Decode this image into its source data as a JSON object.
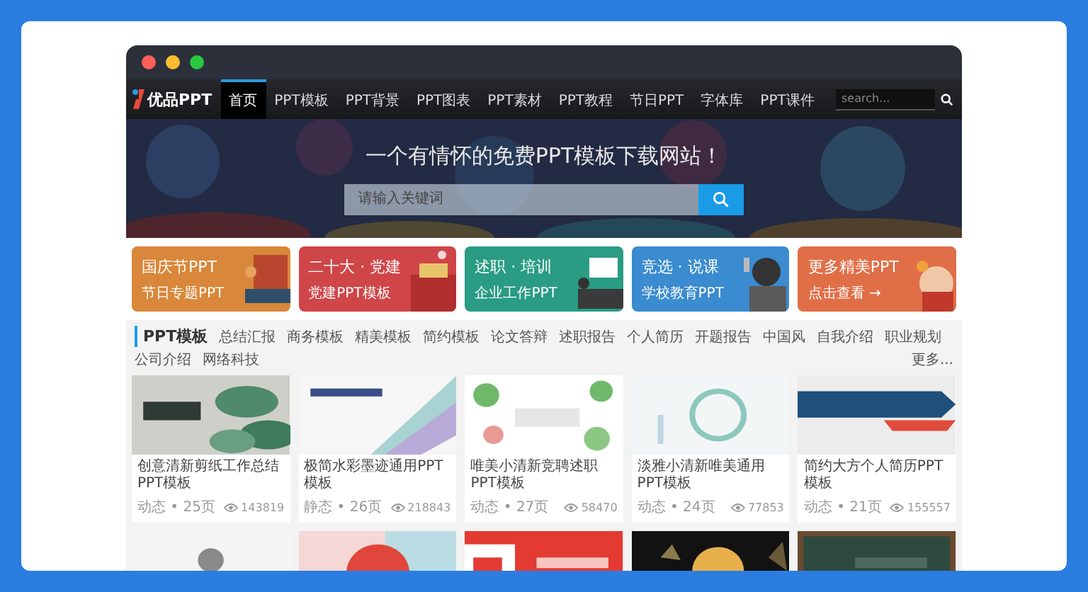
{
  "nav": {
    "logo": "优品PPT",
    "items": [
      {
        "label": "首页",
        "selected": true
      },
      {
        "label": "PPT模板",
        "selected": false
      },
      {
        "label": "PPT背景",
        "selected": false
      },
      {
        "label": "PPT图表",
        "selected": false
      },
      {
        "label": "PPT素材",
        "selected": false
      },
      {
        "label": "PPT教程",
        "selected": false
      },
      {
        "label": "节日PPT",
        "selected": false
      },
      {
        "label": "字体库",
        "selected": false
      },
      {
        "label": "PPT课件",
        "selected": false
      }
    ],
    "search": {
      "placeholder": "search..."
    }
  },
  "banner": {
    "title": "一个有情怀的免费PPT模板下载网站！",
    "search": {
      "placeholder": "请输入关键词"
    }
  },
  "categories": [
    {
      "title": "国庆节PPT",
      "subtitle": "节日专题PPT",
      "color": "#d9873a"
    },
    {
      "title": "二十大 · 党建",
      "subtitle": "党建PPT模板",
      "color": "#cf4548"
    },
    {
      "title": "述职 · 培训",
      "subtitle": "企业工作PPT",
      "color": "#2a9c84"
    },
    {
      "title": "竞选 · 说课",
      "subtitle": "学校教育PPT",
      "color": "#3a8bcf"
    },
    {
      "title": "更多精美PPT",
      "subtitle": "点击查看 →",
      "color": "#e06f48"
    }
  ],
  "section": {
    "heading": "PPT模板",
    "links": [
      "总结汇报",
      "商务模板",
      "精美模板",
      "简约模板",
      "论文答辩",
      "述职报告",
      "个人简历",
      "开题报告",
      "中国风",
      "自我介绍",
      "职业规划",
      "公司介绍",
      "网络科技"
    ],
    "more": "更多..."
  },
  "templates": [
    {
      "title": "创意清新剪纸工作总结PPT模板",
      "meta": "动态 • 25页",
      "views": "143819"
    },
    {
      "title": "极简水彩墨迹通用PPT模板",
      "meta": "静态 • 26页",
      "views": "218843"
    },
    {
      "title": "唯美小清新竞聘述职PPT模板",
      "meta": "动态 • 27页",
      "views": "58470"
    },
    {
      "title": "淡雅小清新唯美通用PPT模板",
      "meta": "动态 • 24页",
      "views": "77853"
    },
    {
      "title": "简约大方个人简历PPT模板",
      "meta": "动态 • 21页",
      "views": "155557"
    }
  ]
}
